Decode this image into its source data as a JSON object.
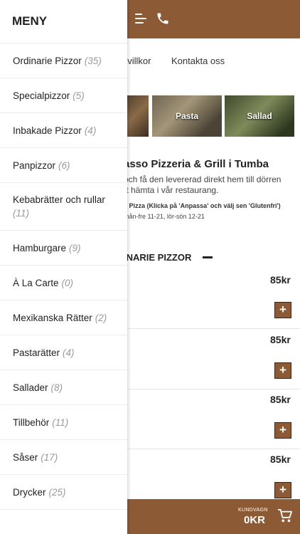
{
  "header": {
    "menu_icon": "hamburger-icon",
    "phone_icon": "phone-icon"
  },
  "nav": {
    "item1": "pvillkor",
    "item2": "Kontakta oss"
  },
  "tiles": [
    {
      "label": ""
    },
    {
      "label": "Pasta"
    },
    {
      "label": "Sallad"
    }
  ],
  "about": {
    "title": "asso Pizzeria & Grill i Tumba",
    "line1": "och få den levererad direkt hem till dörren",
    "line2": "tt hämta i vår restaurang.",
    "line3": "å Pizza (Klicka på 'Anpassa' och välj sen 'Glutenfri')",
    "line4": "mån-fre 11-21, lör-sön 12-21"
  },
  "section": {
    "title": "INARIE PIZZOR"
  },
  "products": [
    {
      "price": "85kr",
      "add": "+"
    },
    {
      "price": "85kr",
      "add": "+"
    },
    {
      "price": "85kr",
      "add": "+"
    },
    {
      "price": "85kr",
      "add": "+"
    }
  ],
  "cart": {
    "label": "KUNDVAGN",
    "amount": "0KR",
    "icon": "cart-icon"
  },
  "drawer": {
    "title": "MENY",
    "items": [
      {
        "label": "Ordinarie Pizzor",
        "count": "(35)"
      },
      {
        "label": "Specialpizzor",
        "count": "(5)"
      },
      {
        "label": "Inbakade Pizzor",
        "count": "(4)"
      },
      {
        "label": "Panpizzor",
        "count": "(6)"
      },
      {
        "label": "Kebabrätter och rullar",
        "count": "(11)"
      },
      {
        "label": "Hamburgare",
        "count": "(9)"
      },
      {
        "label": "À La Carte",
        "count": "(0)"
      },
      {
        "label": "Mexikanska Rätter",
        "count": "(2)"
      },
      {
        "label": "Pastarätter",
        "count": "(4)"
      },
      {
        "label": "Sallader",
        "count": "(8)"
      },
      {
        "label": "Tillbehör",
        "count": "(11)"
      },
      {
        "label": "Såser",
        "count": "(17)"
      },
      {
        "label": "Drycker",
        "count": "(25)"
      }
    ]
  },
  "colors": {
    "brand": "#8d5a36"
  }
}
